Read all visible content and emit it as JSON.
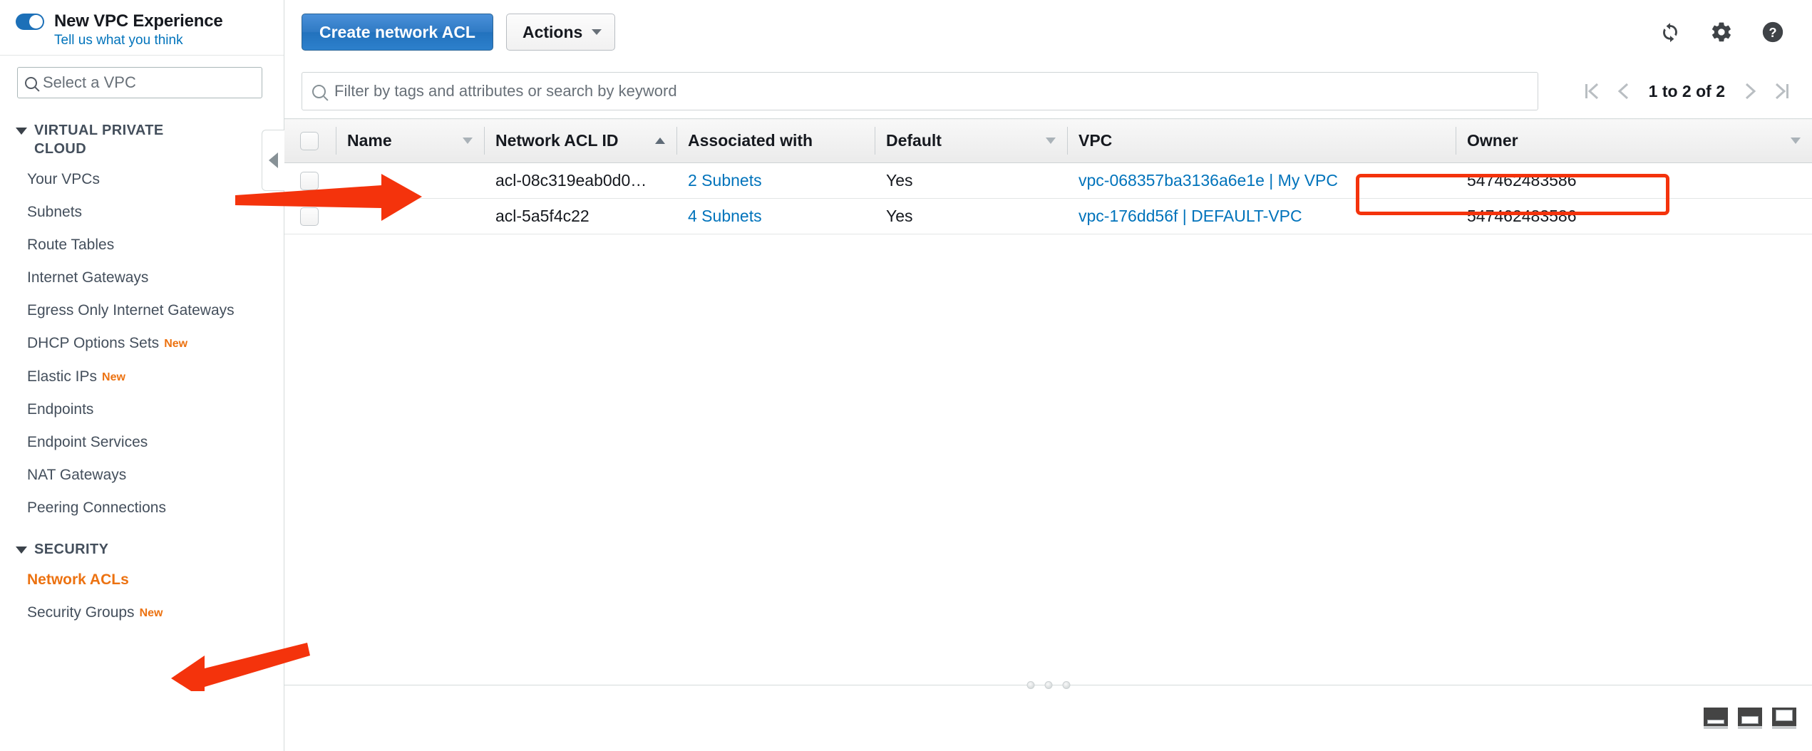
{
  "sidebar": {
    "experience": {
      "title": "New VPC Experience",
      "feedback_link": "Tell us what you think",
      "toggle_state": "on"
    },
    "vpc_select_placeholder": "Select a VPC",
    "groups": [
      {
        "label": "VIRTUAL PRIVATE CLOUD",
        "expanded": true,
        "items": [
          {
            "label": "Your VPCs",
            "badge": "",
            "selected": false
          },
          {
            "label": "Subnets",
            "badge": "",
            "selected": false
          },
          {
            "label": "Route Tables",
            "badge": "",
            "selected": false
          },
          {
            "label": "Internet Gateways",
            "badge": "",
            "selected": false
          },
          {
            "label": "Egress Only Internet Gateways",
            "badge": "",
            "selected": false
          },
          {
            "label": "DHCP Options Sets",
            "badge": "New",
            "selected": false
          },
          {
            "label": "Elastic IPs",
            "badge": "New",
            "selected": false
          },
          {
            "label": "Endpoints",
            "badge": "",
            "selected": false
          },
          {
            "label": "Endpoint Services",
            "badge": "",
            "selected": false
          },
          {
            "label": "NAT Gateways",
            "badge": "",
            "selected": false
          },
          {
            "label": "Peering Connections",
            "badge": "",
            "selected": false
          }
        ]
      },
      {
        "label": "SECURITY",
        "expanded": true,
        "items": [
          {
            "label": "Network ACLs",
            "badge": "",
            "selected": true
          },
          {
            "label": "Security Groups",
            "badge": "New",
            "selected": false
          }
        ]
      }
    ]
  },
  "toolbar": {
    "create_label": "Create network ACL",
    "actions_label": "Actions",
    "refresh_icon": "refresh-icon",
    "settings_icon": "gear-icon",
    "help_icon": "help-icon"
  },
  "filter": {
    "placeholder": "Filter by tags and attributes or search by keyword",
    "search_icon": "search-icon",
    "value": ""
  },
  "pagination": {
    "first_icon": "first-page-icon",
    "prev_icon": "previous-page-icon",
    "label": "1 to 2 of 2",
    "next_icon": "next-page-icon",
    "last_icon": "last-page-icon"
  },
  "table": {
    "columns": [
      {
        "label": "Name",
        "sort": "desc-inactive"
      },
      {
        "label": "Network ACL ID",
        "sort": "asc-active"
      },
      {
        "label": "Associated with",
        "sort": "none"
      },
      {
        "label": "Default",
        "sort": "desc-inactive"
      },
      {
        "label": "VPC",
        "sort": "none"
      },
      {
        "label": "Owner",
        "sort": "desc-inactive"
      }
    ],
    "rows": [
      {
        "name": "",
        "acl_id": "acl-08c319eab0d0…",
        "associated_with": "2 Subnets",
        "default": "Yes",
        "vpc": "vpc-068357ba3136a6e1e | My VPC",
        "owner": "547462483586",
        "highlighted": true
      },
      {
        "name": "",
        "acl_id": "acl-5a5f4c22",
        "associated_with": "4 Subnets",
        "default": "Yes",
        "vpc": "vpc-176dd56f | DEFAULT-VPC",
        "owner": "547462483586",
        "highlighted": false
      }
    ]
  },
  "panel_layout": {
    "options": [
      "split-bottom-small",
      "split-bottom-medium",
      "split-bottom-large"
    ]
  },
  "annotations": {
    "arrow_to_row": "red-arrow-pointing-right-at-first-row",
    "arrow_to_nav": "red-arrow-pointing-left-at-network-acls",
    "highlight_box": "red-box-around-first-vpc-link",
    "accent_color": "#ec7211",
    "link_color": "#0073bb",
    "annotation_color": "#f4330c"
  }
}
